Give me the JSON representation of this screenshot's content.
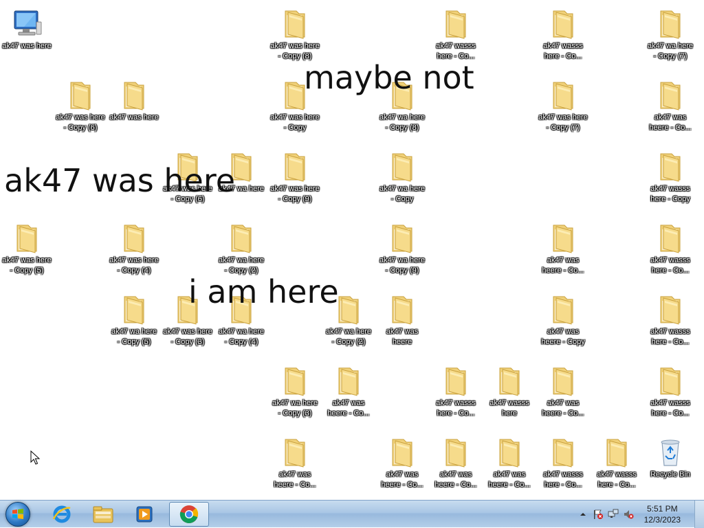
{
  "desktop": {
    "overlay_texts": [
      "maybe not",
      "ak47 was here",
      "i am here"
    ],
    "icons": [
      {
        "type": "computer",
        "label": "ak47 was here"
      },
      {
        "type": "folder",
        "label": "ak47 was here\n- Copy (8)"
      },
      {
        "type": "folder",
        "label": "ak47 wasss\nhere - Co..."
      },
      {
        "type": "folder",
        "label": "ak47 wasss\nhere - Co..."
      },
      {
        "type": "folder",
        "label": "ak47 wa here\n- Copy (7)"
      },
      {
        "type": "folder",
        "label": "ak47 was here\n- Copy (6)"
      },
      {
        "type": "folder",
        "label": "ak47 was here"
      },
      {
        "type": "folder",
        "label": "ak47 was here\n- Copy"
      },
      {
        "type": "folder",
        "label": "ak47 wa here\n- Copy (8)"
      },
      {
        "type": "folder",
        "label": "ak47 was here\n- Copy (7)"
      },
      {
        "type": "folder",
        "label": "ak47 was\nheere - Co..."
      },
      {
        "type": "folder",
        "label": "ak47 was here\n- Copy (6)"
      },
      {
        "type": "folder",
        "label": "ak47 wa here"
      },
      {
        "type": "folder",
        "label": "ak47 was here\n- Copy (9)"
      },
      {
        "type": "folder",
        "label": "ak47 wa here\n- Copy"
      },
      {
        "type": "folder",
        "label": "ak47 wasss\nhere - Copy"
      },
      {
        "type": "folder",
        "label": "ak47 was here\n- Copy (5)"
      },
      {
        "type": "folder",
        "label": "ak47 was here\n- Copy (4)"
      },
      {
        "type": "folder",
        "label": "ak47 wa here\n- Copy (2)"
      },
      {
        "type": "folder",
        "label": "ak47 wa here\n- Copy (9)"
      },
      {
        "type": "folder",
        "label": "ak47 was\nheere - Co..."
      },
      {
        "type": "folder",
        "label": "ak47 wasss\nhere - Co..."
      },
      {
        "type": "folder",
        "label": "ak47 wa here\n- Copy (5)"
      },
      {
        "type": "folder",
        "label": "ak47 was here\n- Copy (3)"
      },
      {
        "type": "folder",
        "label": "ak47 wa here\n- Copy (4)"
      },
      {
        "type": "folder",
        "label": "ak47 wa here\n- Copy (2)"
      },
      {
        "type": "folder",
        "label": "ak47 was\nheere"
      },
      {
        "type": "folder",
        "label": "ak47 was\nheere - Copy"
      },
      {
        "type": "folder",
        "label": "ak47 wasss\nhere - Co..."
      },
      {
        "type": "folder",
        "label": "ak47 wa here\n- Copy (3)"
      },
      {
        "type": "folder",
        "label": "ak47 was\nheere - Co..."
      },
      {
        "type": "folder",
        "label": "ak47 wasss\nhere - Co..."
      },
      {
        "type": "folder",
        "label": "ak47 wasss\nhere"
      },
      {
        "type": "folder",
        "label": "ak47 was\nheere - Co..."
      },
      {
        "type": "folder",
        "label": "ak47 wasss\nhere - Co..."
      },
      {
        "type": "folder",
        "label": "ak47 was\nheere - Co..."
      },
      {
        "type": "folder",
        "label": "ak47 was\nheere - Co..."
      },
      {
        "type": "folder",
        "label": "ak47 was\nheere - Co..."
      },
      {
        "type": "folder",
        "label": "ak47 was\nheere - Co..."
      },
      {
        "type": "folder",
        "label": "ak47 wasss\nhere - Co..."
      },
      {
        "type": "folder",
        "label": "ak47 wasss\nhere - Co..."
      },
      {
        "type": "recycle-bin",
        "label": "Recycle Bin"
      }
    ]
  },
  "taskbar": {
    "pinned": [
      {
        "name": "start-orb-icon"
      },
      {
        "name": "internet-explorer-icon"
      },
      {
        "name": "windows-explorer-icon"
      },
      {
        "name": "media-player-icon"
      },
      {
        "name": "chrome-icon"
      }
    ],
    "clock": {
      "time": "5:51 PM",
      "date": "12/3/2023"
    },
    "tray_icons": [
      "show-hidden-icons-arrow",
      "action-center-flag-icon",
      "network-icon",
      "volume-muted-icon"
    ]
  }
}
